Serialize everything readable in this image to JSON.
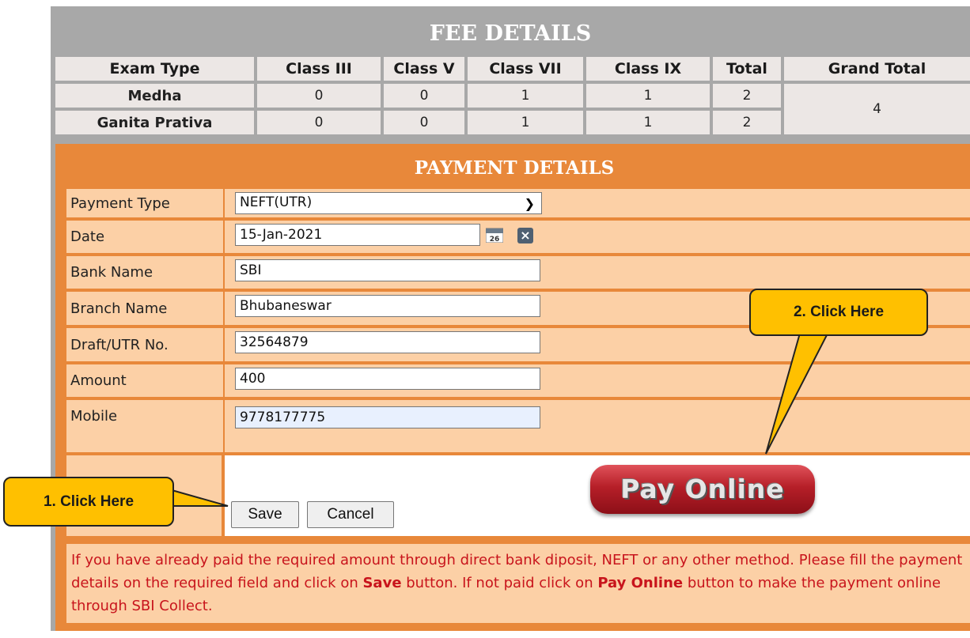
{
  "fee": {
    "title": "FEE DETAILS",
    "headers": [
      "Exam Type",
      "Class III",
      "Class V",
      "Class VII",
      "Class IX",
      "Total",
      "Grand Total"
    ],
    "rows": [
      {
        "exam": "Medha",
        "c3": "0",
        "c5": "0",
        "c7": "1",
        "c9": "1",
        "total": "2"
      },
      {
        "exam": "Ganita Prativa",
        "c3": "0",
        "c5": "0",
        "c7": "1",
        "c9": "1",
        "total": "2"
      }
    ],
    "grand_total": "4"
  },
  "payment": {
    "title": "PAYMENT DETAILS",
    "payment_type": {
      "label": "Payment Type",
      "value": "NEFT(UTR)"
    },
    "date": {
      "label": "Date",
      "value": "15-Jan-2021"
    },
    "bank": {
      "label": "Bank Name",
      "value": "SBI"
    },
    "branch": {
      "label": "Branch Name",
      "value": "Bhubaneswar"
    },
    "utr": {
      "label": "Draft/UTR No.",
      "value": "32564879"
    },
    "amount": {
      "label": "Amount",
      "value": "400"
    },
    "mobile": {
      "label": "Mobile",
      "value": "9778177775"
    },
    "calendar_day": "26",
    "save_label": "Save",
    "cancel_label": "Cancel",
    "pay_online_label": "Pay Online"
  },
  "info": {
    "text1": "If you have already paid the required amount through direct bank diposit, NEFT or any other method. Please fill the payment details on the required field and click on ",
    "save_word": "Save",
    "text2": " button. If not paid click on ",
    "pay_word": "Pay Online",
    "text3": " button to make the payment online through SBI Collect."
  },
  "callouts": {
    "first": "1. Click Here",
    "second": "2. Click Here"
  },
  "colors": {
    "header_gray": "#a8a8a8",
    "orange": "#e8883a",
    "light_orange": "#fcd0a6",
    "callout_yellow": "#ffc000",
    "notice_red": "#c8141c"
  }
}
